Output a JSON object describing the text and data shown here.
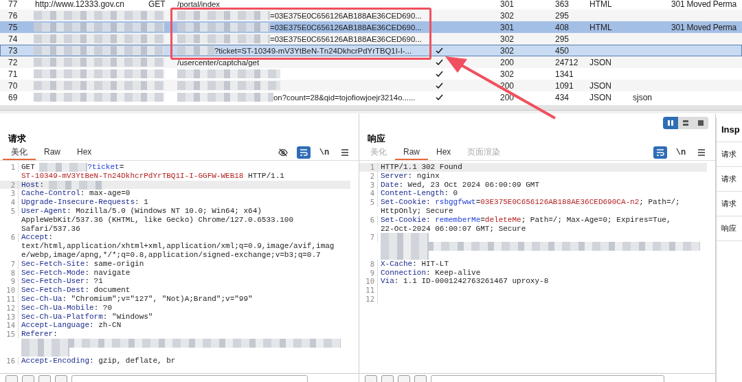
{
  "history": {
    "rows": [
      {
        "number": "77",
        "redacted": false,
        "host": "http://www.12333.gov.cn",
        "method": "GET",
        "url_redacted": false,
        "url": "/portal/index",
        "checked": false,
        "status": "301",
        "length": "363",
        "mime": "HTML",
        "title": "301 Moved Perma",
        "selected": false,
        "highlighted": false
      },
      {
        "number": "76",
        "redacted": true,
        "url_redacted": true,
        "url": "=03E375E0C656126AB188AE36CED690...",
        "checked": false,
        "status": "302",
        "length": "295",
        "selected": false,
        "highlighted": false
      },
      {
        "number": "75",
        "redacted": true,
        "url_redacted": true,
        "url": "=03E375E0C656126AB188AE36CED690...",
        "checked": false,
        "status": "301",
        "length": "408",
        "mime": "HTML",
        "title": "301 Moved Perma",
        "selected": true,
        "highlighted": false
      },
      {
        "number": "74",
        "redacted": true,
        "url_redacted": true,
        "url": "=03E375E0C656126AB188AE36CED690...",
        "checked": false,
        "status": "302",
        "length": "295",
        "selected": false,
        "highlighted": false
      },
      {
        "number": "73",
        "redacted": true,
        "url_redacted": true,
        "url": "?ticket=ST-10349-mV3YtBeN-Tn24DkhcrPdYrTBQ1I-I-...",
        "checked": true,
        "status": "302",
        "length": "450",
        "selected": false,
        "highlighted": true
      },
      {
        "number": "72",
        "redacted": true,
        "url_redacted": false,
        "url": "/usercenter/captcha/get",
        "checked": true,
        "status": "200",
        "length": "24712",
        "mime": "JSON",
        "selected": false,
        "highlighted": false
      },
      {
        "number": "71",
        "redacted": true,
        "url_redacted": true,
        "checked": true,
        "status": "302",
        "length": "1341",
        "selected": false,
        "highlighted": false
      },
      {
        "number": "70",
        "redacted": true,
        "url_redacted": true,
        "checked": true,
        "status": "200",
        "length": "1091",
        "mime": "JSON",
        "selected": false,
        "highlighted": false
      },
      {
        "number": "69",
        "redacted": true,
        "url_redacted": true,
        "url": "on?count=28&qid=tojofiowjoejr3214o......",
        "checked": true,
        "status": "200",
        "length": "434",
        "mime": "JSON",
        "extension": "sjson",
        "selected": false,
        "highlighted": false
      }
    ]
  },
  "request": {
    "title": "请求",
    "tabs": [
      {
        "label": "美化",
        "selected": true,
        "disabled": false
      },
      {
        "label": "Raw",
        "selected": false,
        "disabled": false
      },
      {
        "label": "Hex",
        "selected": false,
        "disabled": false
      }
    ],
    "tools": [
      {
        "kind": "hide"
      },
      {
        "kind": "wrap",
        "on": true
      },
      {
        "kind": "newline",
        "label": "\\n"
      },
      {
        "kind": "menu"
      }
    ],
    "lines": [
      {
        "number": "1",
        "highlighted": false,
        "rows": [
          [
            {
              "kind": "plain",
              "text": "GET "
            },
            {
              "kind": "redacted_short"
            },
            {
              "kind": "param",
              "text": "?ticket"
            },
            {
              "kind": "plain",
              "text": "="
            }
          ],
          [
            {
              "kind": "value",
              "text": "ST-10349-mV3YtBeN-Tn24DkhcrPdYrTBQ1I-I-GGFW-WEB18"
            },
            {
              "kind": "plain",
              "text": " HTTP/1.1"
            }
          ]
        ]
      },
      {
        "number": "2",
        "highlighted": true,
        "rows": [
          [
            {
              "kind": "key",
              "text": "Host"
            },
            {
              "kind": "plain",
              "text": ": "
            },
            {
              "kind": "redacted_long"
            }
          ]
        ]
      },
      {
        "number": "3",
        "highlighted": false,
        "rows": [
          [
            {
              "kind": "key",
              "text": "Cache-Control"
            },
            {
              "kind": "plain",
              "text": ": max-age=0"
            }
          ]
        ]
      },
      {
        "number": "4",
        "highlighted": false,
        "rows": [
          [
            {
              "kind": "key",
              "text": "Upgrade-Insecure-Requests"
            },
            {
              "kind": "plain",
              "text": ": 1"
            }
          ]
        ]
      },
      {
        "number": "5",
        "highlighted": false,
        "rows": [
          [
            {
              "kind": "key",
              "text": "User-Agent"
            },
            {
              "kind": "plain",
              "text": ": Mozilla/5.0 (Windows NT 10.0; Win64; x64)"
            }
          ],
          [
            {
              "kind": "plain",
              "text": "AppleWebKit/537.36 (KHTML, like Gecko) Chrome/127.0.6533.100"
            }
          ],
          [
            {
              "kind": "plain",
              "text": "Safari/537.36"
            }
          ]
        ]
      },
      {
        "number": "6",
        "highlighted": false,
        "rows": [
          [
            {
              "kind": "key",
              "text": "Accept"
            },
            {
              "kind": "plain",
              "text": ":"
            }
          ],
          [
            {
              "kind": "plain",
              "text": "text/html,application/xhtml+xml,application/xml;q=0.9,image/avif,imag"
            }
          ],
          [
            {
              "kind": "plain",
              "text": "e/webp,image/apng,*/*;q=0.8,application/signed-exchange;v=b3;q=0.7"
            }
          ]
        ]
      },
      {
        "number": "7",
        "highlighted": false,
        "rows": [
          [
            {
              "kind": "key",
              "text": "Sec-Fetch-Site"
            },
            {
              "kind": "plain",
              "text": ": same-origin"
            }
          ]
        ]
      },
      {
        "number": "8",
        "highlighted": false,
        "rows": [
          [
            {
              "kind": "key",
              "text": "Sec-Fetch-Mode"
            },
            {
              "kind": "plain",
              "text": ": navigate"
            }
          ]
        ]
      },
      {
        "number": "9",
        "highlighted": false,
        "rows": [
          [
            {
              "kind": "key",
              "text": "Sec-Fetch-User"
            },
            {
              "kind": "plain",
              "text": ": ?1"
            }
          ]
        ]
      },
      {
        "number": "10",
        "highlighted": false,
        "rows": [
          [
            {
              "kind": "key",
              "text": "Sec-Fetch-Dest"
            },
            {
              "kind": "plain",
              "text": ": document"
            }
          ]
        ]
      },
      {
        "number": "11",
        "highlighted": false,
        "rows": [
          [
            {
              "kind": "key",
              "text": "Sec-Ch-Ua"
            },
            {
              "kind": "plain",
              "text": ": \"Chromium\";v=\"127\", \"Not)A;Brand\";v=\"99\""
            }
          ]
        ]
      },
      {
        "number": "12",
        "highlighted": false,
        "rows": [
          [
            {
              "kind": "key",
              "text": "Sec-Ch-Ua-Mobile"
            },
            {
              "kind": "plain",
              "text": ": ?0"
            }
          ]
        ]
      },
      {
        "number": "13",
        "highlighted": false,
        "rows": [
          [
            {
              "kind": "key",
              "text": "Sec-Ch-Ua-Platform"
            },
            {
              "kind": "plain",
              "text": ": \"Windows\""
            }
          ]
        ]
      },
      {
        "number": "14",
        "highlighted": false,
        "rows": [
          [
            {
              "kind": "key",
              "text": "Accept-Language"
            },
            {
              "kind": "plain",
              "text": ": zh-CN"
            }
          ]
        ]
      },
      {
        "number": "15",
        "highlighted": false,
        "rows": [
          [
            {
              "kind": "key",
              "text": "Referer"
            },
            {
              "kind": "plain",
              "text": ":"
            }
          ],
          [
            {
              "kind": "redacted_full"
            }
          ],
          [
            {
              "kind": "redacted_short"
            }
          ]
        ]
      },
      {
        "number": "16",
        "highlighted": false,
        "rows": [
          [
            {
              "kind": "key",
              "text": "Accept-Encoding"
            },
            {
              "kind": "plain",
              "text": ": gzip, deflate, br"
            }
          ]
        ]
      }
    ]
  },
  "response": {
    "title": "响应",
    "tabs": [
      {
        "label": "美化",
        "selected": false,
        "disabled": true
      },
      {
        "label": "Raw",
        "selected": true,
        "disabled": false
      },
      {
        "label": "Hex",
        "selected": false,
        "disabled": false
      },
      {
        "label": "页面渲染",
        "selected": false,
        "disabled": true
      }
    ],
    "tools": [
      {
        "kind": "wrap",
        "on": true
      },
      {
        "kind": "newline",
        "label": "\\n"
      },
      {
        "kind": "menu"
      }
    ],
    "layout_buttons": [
      {
        "kind": "columns",
        "selected": true
      },
      {
        "kind": "rows",
        "selected": false
      },
      {
        "kind": "single",
        "selected": false
      }
    ],
    "lines": [
      {
        "number": "1",
        "highlighted": true,
        "rows": [
          [
            {
              "kind": "plain",
              "text": "HTTP/1.1 302 Found"
            }
          ]
        ]
      },
      {
        "number": "2",
        "highlighted": false,
        "rows": [
          [
            {
              "kind": "key",
              "text": "Server"
            },
            {
              "kind": "plain",
              "text": ": nginx"
            }
          ]
        ]
      },
      {
        "number": "3",
        "highlighted": false,
        "rows": [
          [
            {
              "kind": "key",
              "text": "Date"
            },
            {
              "kind": "plain",
              "text": ": Wed, 23 Oct 2024 06:00:09 GMT"
            }
          ]
        ]
      },
      {
        "number": "4",
        "highlighted": false,
        "rows": [
          [
            {
              "kind": "key",
              "text": "Content-Length"
            },
            {
              "kind": "plain",
              "text": ": 0"
            }
          ]
        ]
      },
      {
        "number": "5",
        "highlighted": false,
        "rows": [
          [
            {
              "kind": "key",
              "text": "Set-Cookie"
            },
            {
              "kind": "plain",
              "text": ": "
            },
            {
              "kind": "param",
              "text": "rsbggfwwt"
            },
            {
              "kind": "plain",
              "text": "="
            },
            {
              "kind": "value",
              "text": "03E375E0C656126AB188AE36CED690CA-n2"
            },
            {
              "kind": "plain",
              "text": "; Path=/;"
            }
          ],
          [
            {
              "kind": "plain",
              "text": "HttpOnly; Secure"
            }
          ]
        ]
      },
      {
        "number": "6",
        "highlighted": false,
        "rows": [
          [
            {
              "kind": "key",
              "text": "Set-Cookie"
            },
            {
              "kind": "plain",
              "text": ": "
            },
            {
              "kind": "param",
              "text": "rememberMe"
            },
            {
              "kind": "plain",
              "text": "="
            },
            {
              "kind": "value",
              "text": "deleteMe"
            },
            {
              "kind": "plain",
              "text": "; Path=/; Max-Age=0; Expires=Tue,"
            }
          ],
          [
            {
              "kind": "plain",
              "text": "22-Oct-2024 06:00:07 GMT; Secure"
            }
          ]
        ]
      },
      {
        "number": "7",
        "highlighted": false,
        "rows": [
          [
            {
              "kind": "redacted_short"
            }
          ],
          [
            {
              "kind": "redacted_full"
            }
          ],
          [
            {
              "kind": "redacted_short"
            }
          ]
        ]
      },
      {
        "number": "8",
        "highlighted": false,
        "rows": [
          [
            {
              "kind": "key",
              "text": "X-Cache"
            },
            {
              "kind": "plain",
              "text": ": HIT-LT"
            }
          ]
        ]
      },
      {
        "number": "9",
        "highlighted": false,
        "rows": [
          [
            {
              "kind": "key",
              "text": "Connection"
            },
            {
              "kind": "plain",
              "text": ": Keep-alive"
            }
          ]
        ]
      },
      {
        "number": "10",
        "highlighted": false,
        "rows": [
          [
            {
              "kind": "key",
              "text": "Via"
            },
            {
              "kind": "plain",
              "text": ": 1.1 ID-0001242763261467 uproxy-8"
            }
          ]
        ]
      },
      {
        "number": "11",
        "highlighted": false,
        "rows": [
          []
        ]
      },
      {
        "number": "12",
        "highlighted": false,
        "rows": [
          []
        ]
      }
    ]
  },
  "inspector": {
    "title": "Insp",
    "items": [
      {
        "label": "请求"
      },
      {
        "label": "请求"
      },
      {
        "label": "请求"
      },
      {
        "label": "响应"
      }
    ]
  }
}
